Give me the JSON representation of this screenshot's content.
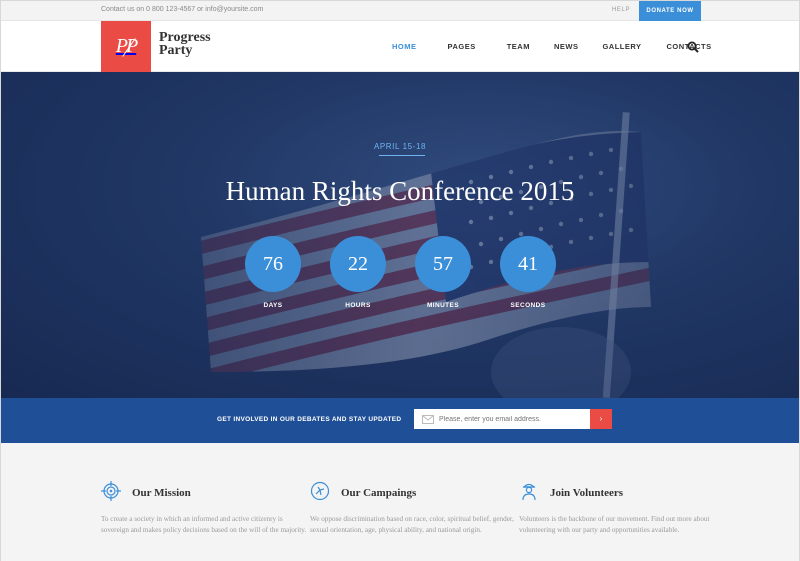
{
  "topbar": {
    "contact": "Contact us on 0 800 123-4567 or info@yoursite.com",
    "help": "HELP",
    "donate": "DONATE NOW"
  },
  "header": {
    "logo_text": "PP",
    "brand_line1": "Progress",
    "brand_line2": "Party",
    "nav": [
      "HOME",
      "PAGES",
      "TEAM",
      "NEWS",
      "GALLERY",
      "CONTACTS"
    ],
    "active_nav": "HOME"
  },
  "hero": {
    "date": "APRIL 15-18",
    "title": "Human Rights Conference 2015",
    "countdown": [
      {
        "value": "76",
        "label": "DAYS"
      },
      {
        "value": "22",
        "label": "HOURS"
      },
      {
        "value": "57",
        "label": "MINUTES"
      },
      {
        "value": "41",
        "label": "SECONDS"
      }
    ]
  },
  "subscribe": {
    "text": "GET INVOLVED IN OUR DEBATES AND STAY UPDATED",
    "placeholder": "Please, enter you email address.",
    "button": "›"
  },
  "features": [
    {
      "title": "Our Mission",
      "icon": "target-icon",
      "text": "To create a society in which an informed and active citizenry is sovereign and makes policy decisions based on the will of the majority."
    },
    {
      "title": "Our Campaings",
      "icon": "campaign-icon",
      "text": "We oppose discrimination based on race, color, spiritual belief, gender, sexual orientation, age, physical ability, and national origin."
    },
    {
      "title": "Join Volunteers",
      "icon": "volunteer-icon",
      "text": "Volunteers is the backbone of our movement. Find out more about volunteering with our party and opportunities available."
    }
  ],
  "colors": {
    "accent": "#3b8fd8",
    "brand": "#ea4b44",
    "band": "#1f4f96"
  }
}
